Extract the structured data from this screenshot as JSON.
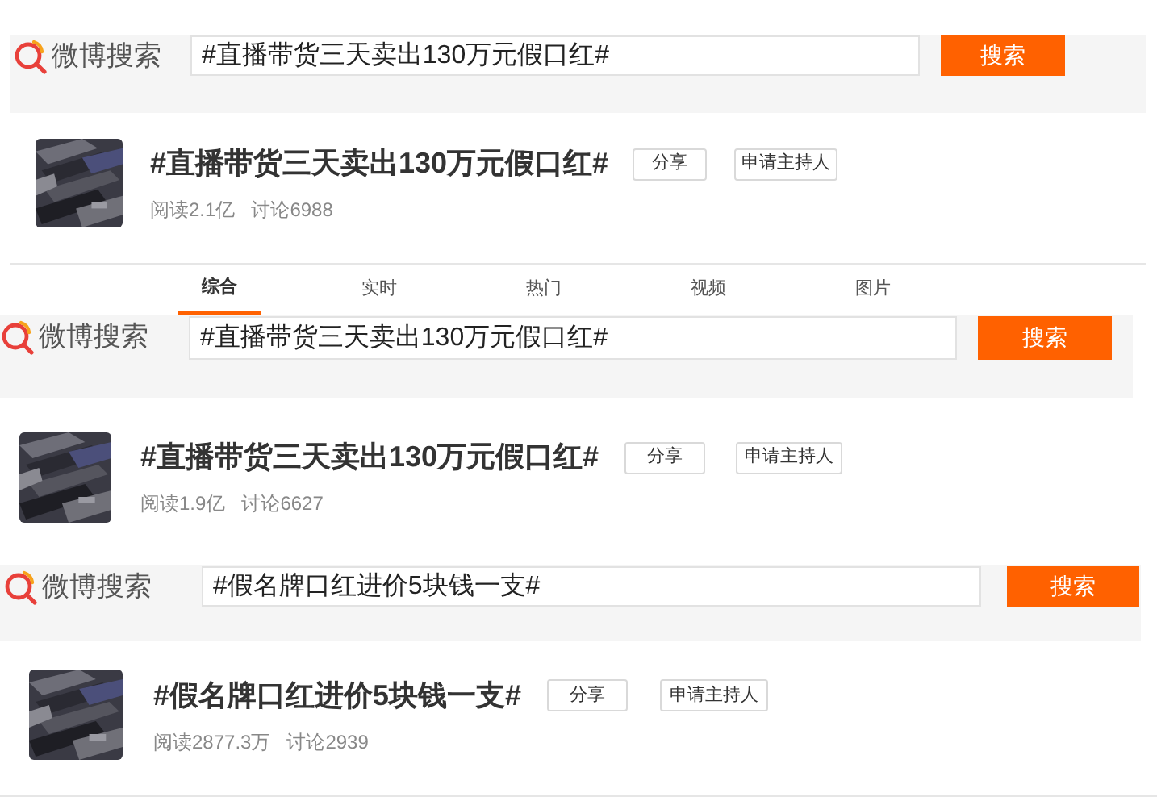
{
  "panels": [
    {
      "logo": "微博搜索",
      "query": "#直播带货三天卖出130万元假口红#",
      "search_button": "搜索",
      "topic": {
        "title": "#直播带货三天卖出130万元假口红#",
        "share_button": "分享",
        "host_button": "申请主持人",
        "reads": "阅读2.1亿",
        "discussions": "讨论6988"
      },
      "tabs": [
        {
          "label": "综合",
          "selected": true
        },
        {
          "label": "实时",
          "selected": false
        },
        {
          "label": "热门",
          "selected": false
        },
        {
          "label": "视频",
          "selected": false
        },
        {
          "label": "图片",
          "selected": false
        }
      ]
    },
    {
      "logo": "微博搜索",
      "query": "#直播带货三天卖出130万元假口红#",
      "search_button": "搜索",
      "topic": {
        "title": "#直播带货三天卖出130万元假口红#",
        "share_button": "分享",
        "host_button": "申请主持人",
        "reads": "阅读1.9亿",
        "discussions": "讨论6627"
      }
    },
    {
      "logo": "微博搜索",
      "query": "#假名牌口红进价5块钱一支#",
      "search_button": "搜索",
      "topic": {
        "title": "#假名牌口红进价5块钱一支#",
        "share_button": "分享",
        "host_button": "申请主持人",
        "reads": "阅读2877.3万",
        "discussions": "讨论2939"
      }
    }
  ]
}
